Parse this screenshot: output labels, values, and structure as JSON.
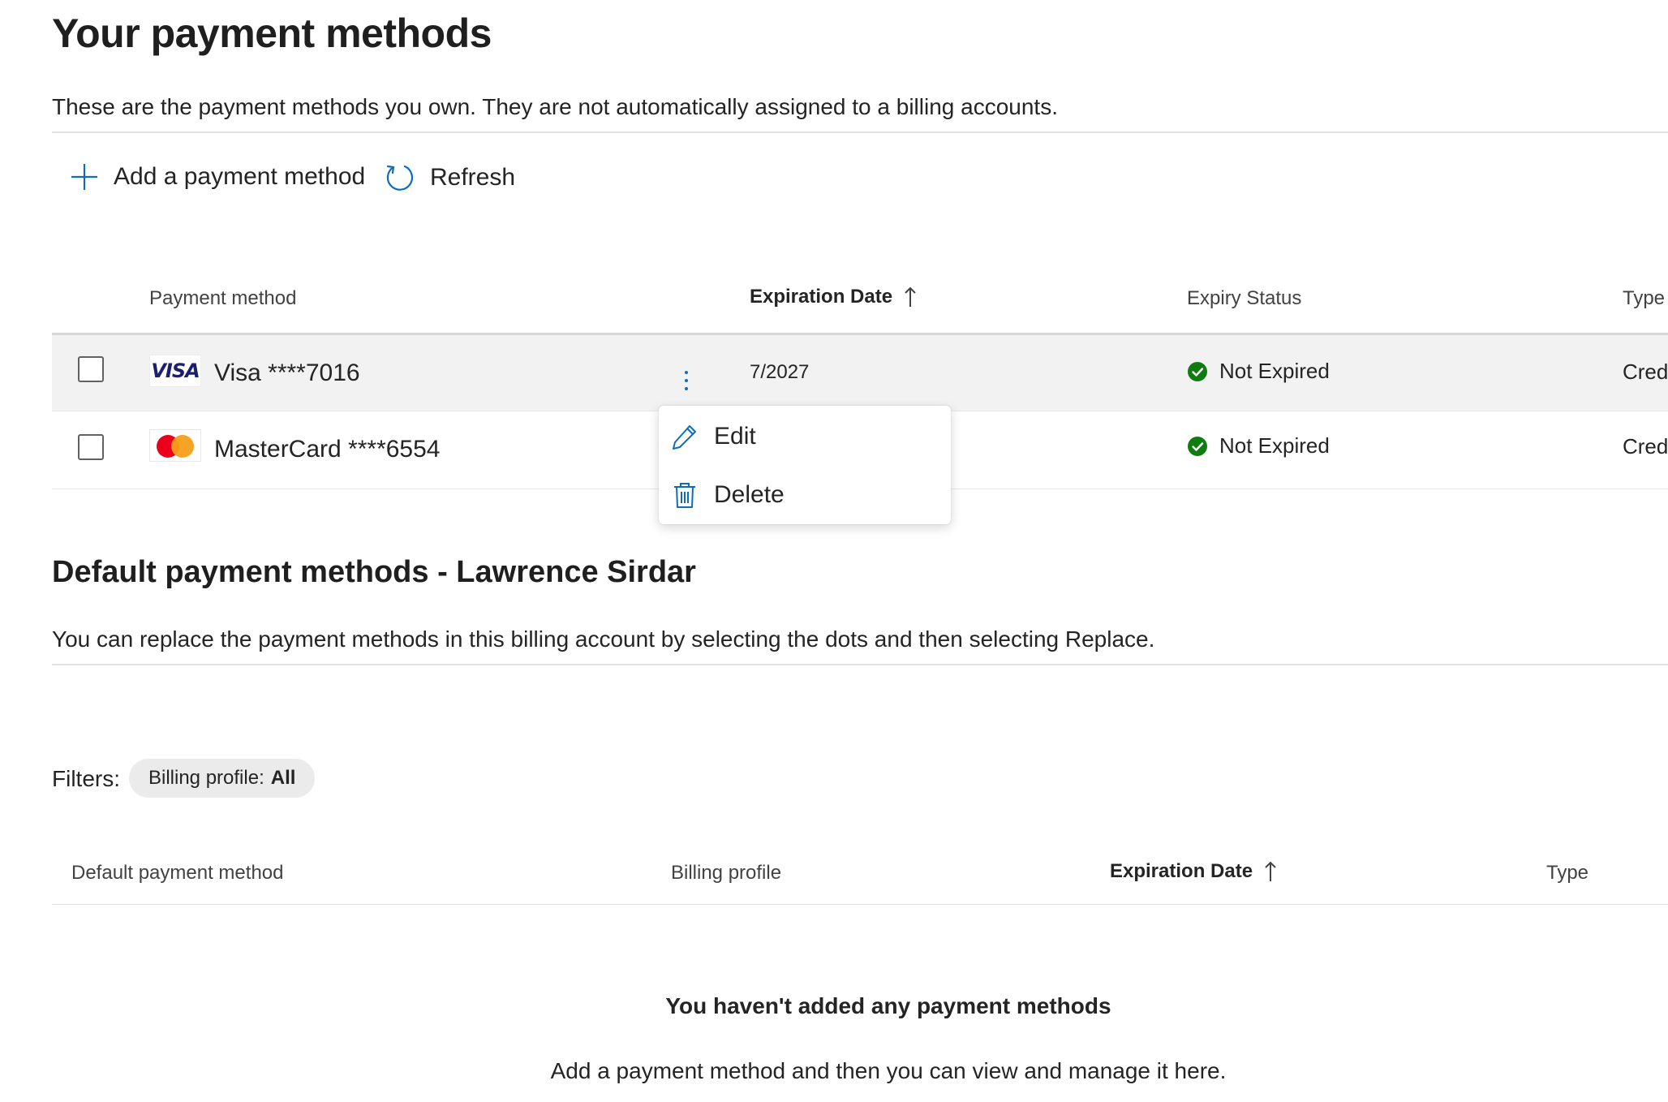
{
  "page": {
    "title": "Your payment methods",
    "description": "These are the payment methods you own. They are not automatically assigned to a billing accounts."
  },
  "toolbar": {
    "add_label": "Add a payment method",
    "refresh_label": "Refresh"
  },
  "payment_table": {
    "columns": {
      "payment_method": "Payment method",
      "expiration_date": "Expiration Date",
      "expiry_status": "Expiry Status",
      "type": "Type"
    },
    "rows": [
      {
        "brand": "VISA",
        "name": "Visa ****7016",
        "expiration": "7/2027",
        "status": "Not Expired",
        "type": "Credi",
        "selected": true
      },
      {
        "brand": "mastercard",
        "name": "MasterCard ****6554",
        "expiration": "",
        "status": "Not Expired",
        "type": "Credi",
        "selected": false
      }
    ]
  },
  "context_menu": {
    "edit_label": "Edit",
    "delete_label": "Delete"
  },
  "default_section": {
    "title": "Default payment methods - Lawrence Sirdar",
    "description": "You can replace the payment methods in this billing account by selecting the dots and then selecting Replace.",
    "filters_label": "Filters:",
    "filter_chip_key": "Billing profile:",
    "filter_chip_value": "All",
    "columns": {
      "default_payment_method": "Default payment method",
      "billing_profile": "Billing profile",
      "expiration_date": "Expiration Date",
      "type": "Type"
    },
    "empty_title": "You haven't added any payment methods",
    "empty_description": "Add a payment method and then you can view and manage it here."
  },
  "colors": {
    "accent": "#0f6cbd",
    "success": "#107c10",
    "selected_row": "#f2f2f2"
  }
}
